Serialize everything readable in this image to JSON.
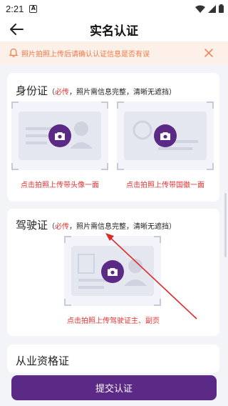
{
  "status_bar": {
    "time": "2:21",
    "notif_letter": "A"
  },
  "header": {
    "title": "实名认证"
  },
  "notice": {
    "text": "照片拍照上传后请确认认证信息是否有误"
  },
  "id_card": {
    "title": "身份证",
    "req_open": "（",
    "req_must": "必传",
    "req_rest": "，照片需信息完整，清晰无遮挡）",
    "front_label": "点击拍照上传带头像一面",
    "back_label": "点击拍照上传带国徽一面"
  },
  "driver_license": {
    "title": "驾驶证",
    "req_open": "（",
    "req_must": "必传",
    "req_rest": "，照片需信息完整，清晰无遮挡）",
    "upload_label": "点击拍照上传驾驶证主、副页"
  },
  "qualification": {
    "title": "从业资格证"
  },
  "submit": {
    "label": "提交认证"
  },
  "colors": {
    "accent": "#5b2a86",
    "required": "#e33232",
    "notice_text": "#ee7a46",
    "notice_bg": "#fdf0e9"
  }
}
